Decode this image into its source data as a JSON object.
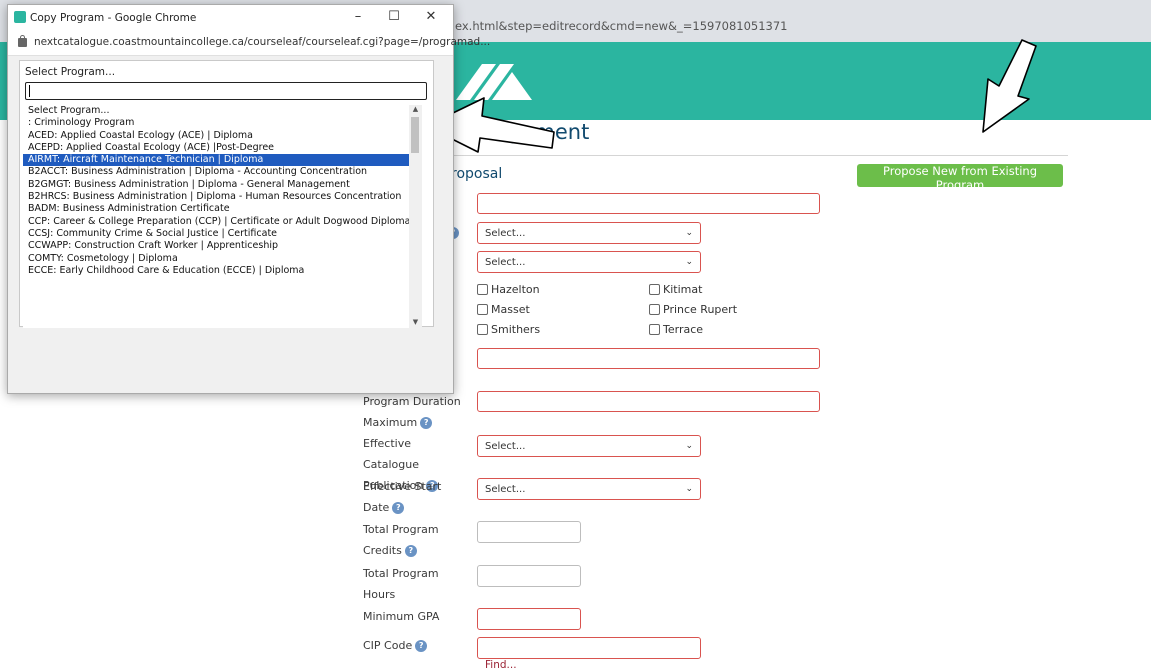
{
  "background": {
    "url_fragment": "ex.html&step=editrecord&cmd=new&_=1597081051371",
    "page_title": "Management",
    "section_title": "roposal",
    "propose_button": "Propose New from Existing Program",
    "campuses": [
      "Hazelton",
      "Kitimat",
      "Masset",
      "Prince Rupert",
      "Smithers",
      "Terrace"
    ],
    "select_placeholder": "Select...",
    "labels": {
      "duration_max": "Program Duration Maximum",
      "effective_catalogue": "Effective Catalogue Publication",
      "effective_start": "Effective Start Date",
      "total_credits": "Total Program Credits",
      "total_hours": "Total Program Hours",
      "min_gpa": "Minimum GPA",
      "cip_code": "CIP Code"
    },
    "find_link": "Find...",
    "colors": {
      "banner": "#2bb5a0",
      "button": "#6cbe4a",
      "title": "#114a6e",
      "required_border": "#d9534f"
    }
  },
  "popup": {
    "window_title": "Copy Program - Google Chrome",
    "url": "nextcatalogue.coastmountaincollege.ca/courseleaf/courseleaf.cgi?page=/programad...",
    "controls": {
      "minimize": "–",
      "maximize": "☐",
      "close": "✕"
    },
    "select_label": "Select Program...",
    "search_value": "",
    "options": [
      "Select Program...",
      ": Criminology Program",
      "ACED: Applied Coastal Ecology (ACE) | Diploma",
      "ACEPD: Applied Coastal Ecology (ACE) |Post-Degree",
      "AIRMT: Aircraft Maintenance Technician | Diploma",
      "B2ACCT: Business Administration | Diploma - Accounting Concentration",
      "B2GMGT: Business Administration | Diploma - General Management",
      "B2HRCS: Business Administration | Diploma - Human Resources Concentration",
      "BADM: Business Administration Certificate",
      "CCP: Career & College Preparation (CCP) | Certificate or Adult Dogwood Diploma",
      "CCSJ: Community Crime & Social Justice | Certificate",
      "CCWAPP: Construction Craft Worker | Apprenticeship",
      "COMTY: Cosmetology | Diploma",
      "ECCE: Early Childhood Care & Education (ECCE) | Diploma"
    ],
    "selected_option": "AIRMT: Aircraft Maintenance Technician | Diploma"
  }
}
